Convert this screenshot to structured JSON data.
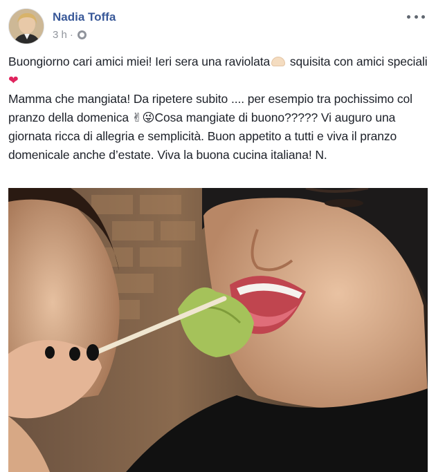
{
  "post": {
    "author": "Nadia Toffa",
    "time": "3 h",
    "separator": "·",
    "more_icon": "ellipsis-icon",
    "privacy_icon": "globe-icon",
    "text": {
      "line1_a": "Buongiorno cari amici miei! Ieri sera una raviolata",
      "line1_b": " squisita con amici speciali ",
      "heart": "❤",
      "line2_a": "Mamma che mangiata! Da ripetere subito .... per esempio tra pochissimo col pranzo della domenica ",
      "victory": "✌",
      "wink": "😜",
      "line2_b": "Cosa mangiate di buono????? Vi auguro una giornata ricca di allegria e semplicità. Buon appetito a tutti e viva il pranzo domenicale anche d’estate. Viva la buona cucina italiana! N."
    }
  },
  "colors": {
    "author_link": "#385898",
    "meta_gray": "#90949c",
    "body_text": "#1d2129",
    "heart": "#e0245e"
  }
}
